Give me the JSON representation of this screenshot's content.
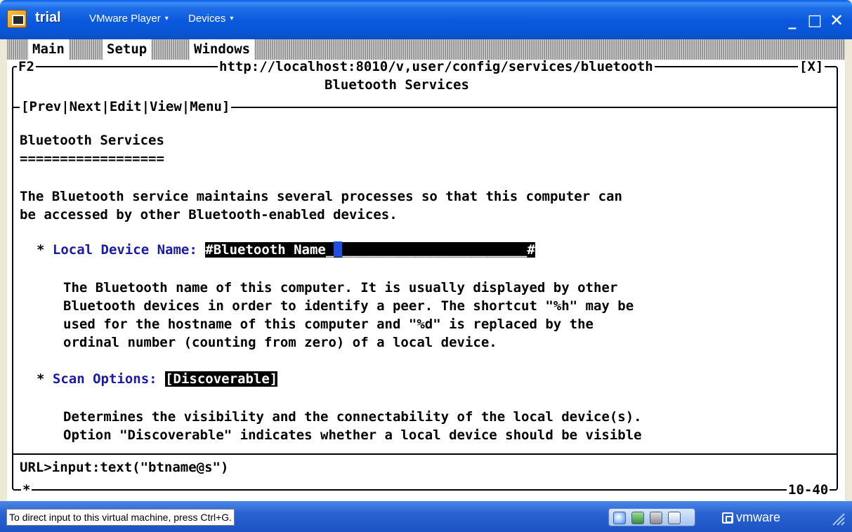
{
  "titlebar": {
    "app_name": "trial",
    "menu_player": "VMware Player",
    "menu_devices": "Devices",
    "caret": "▾",
    "min": "_",
    "max": "□",
    "close": "✕"
  },
  "terminal": {
    "menu": [
      "Main",
      "Setup",
      "Windows"
    ],
    "window_key": "F2",
    "url": "http://localhost:8010/v,user/config/services/bluetooth",
    "close_marker": "[X]",
    "page_title": "Bluetooth Services",
    "nav": "[Prev|Next|Edit|View|Menu]",
    "heading": "Bluetooth Services",
    "underline": "==================",
    "intro": [
      "The Bluetooth service maintains several processes so that this computer can",
      "be accessed by other Bluetooth-enabled devices."
    ],
    "field1": {
      "bullet": "*",
      "label": "Local Device Name:",
      "value_prefix": "#Bluetooth Name_",
      "value_suffix": "_______________________#"
    },
    "field1_help": [
      "The Bluetooth name of this computer. It is usually displayed by other",
      "Bluetooth devices in order to identify a peer. The shortcut \"%h\" may be",
      "used for the hostname of this computer and \"%d\" is replaced by the",
      "ordinal number (counting from zero) of a local device."
    ],
    "field2": {
      "bullet": "*",
      "label": "Scan Options:",
      "value": "[Discoverable]"
    },
    "field2_help": [
      "Determines the visibility and the connectability of the local device(s).",
      "Option \"Discoverable\" indicates whether a local device should be visible"
    ],
    "command_line": "URL>input:text(\"btname@s\")",
    "bottom_left_marker": "*",
    "position_indicator": "10-40"
  },
  "statusbar": {
    "message": "To direct input to this virtual machine, press Ctrl+G.",
    "brand": "vmware"
  }
}
